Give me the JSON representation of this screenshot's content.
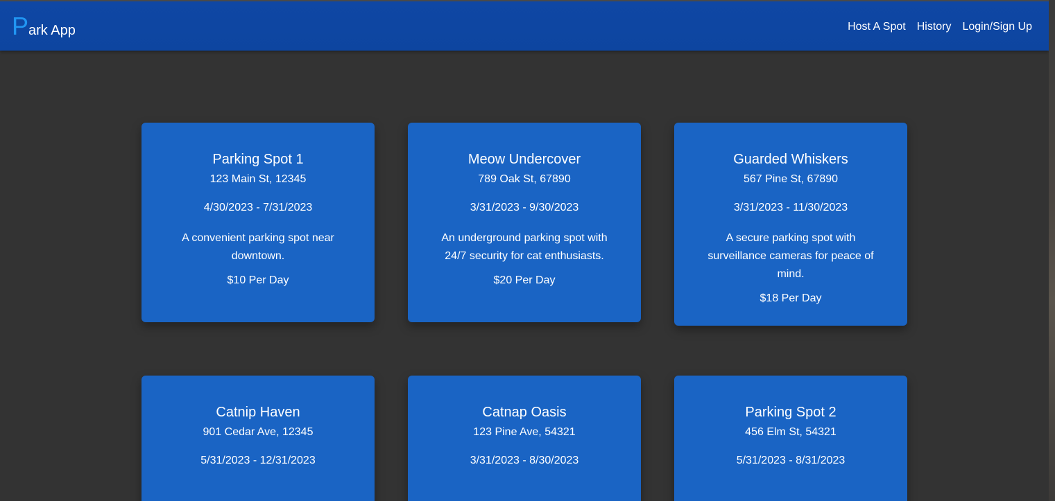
{
  "app": {
    "brand_initial": "P",
    "brand_rest": "ark App"
  },
  "nav": {
    "host": "Host A Spot",
    "history": "History",
    "login": "Login/Sign Up"
  },
  "colors": {
    "topbar": "#0f47a4",
    "card": "#1a64c4",
    "background": "#333333",
    "brand_initial": "#2196f3"
  },
  "spots": [
    {
      "title": "Parking Spot 1",
      "address": "123 Main St, 12345",
      "dates": "4/30/2023 - 7/31/2023",
      "description": "A convenient parking spot near downtown.",
      "price": "$10 Per Day"
    },
    {
      "title": "Meow Undercover",
      "address": "789 Oak St, 67890",
      "dates": "3/31/2023 - 9/30/2023",
      "description": "An underground parking spot with 24/7 security for cat enthusiasts.",
      "price": "$20 Per Day"
    },
    {
      "title": "Guarded Whiskers",
      "address": "567 Pine St, 67890",
      "dates": "3/31/2023 - 11/30/2023",
      "description": "A secure parking spot with surveillance cameras for peace of mind.",
      "price": "$18 Per Day"
    },
    {
      "title": "Catnip Haven",
      "address": "901 Cedar Ave, 12345",
      "dates": "5/31/2023 - 12/31/2023"
    },
    {
      "title": "Catnap Oasis",
      "address": "123 Pine Ave, 54321",
      "dates": "3/31/2023 - 8/30/2023"
    },
    {
      "title": "Parking Spot 2",
      "address": "456 Elm St, 54321",
      "dates": "5/31/2023 - 8/31/2023"
    }
  ]
}
